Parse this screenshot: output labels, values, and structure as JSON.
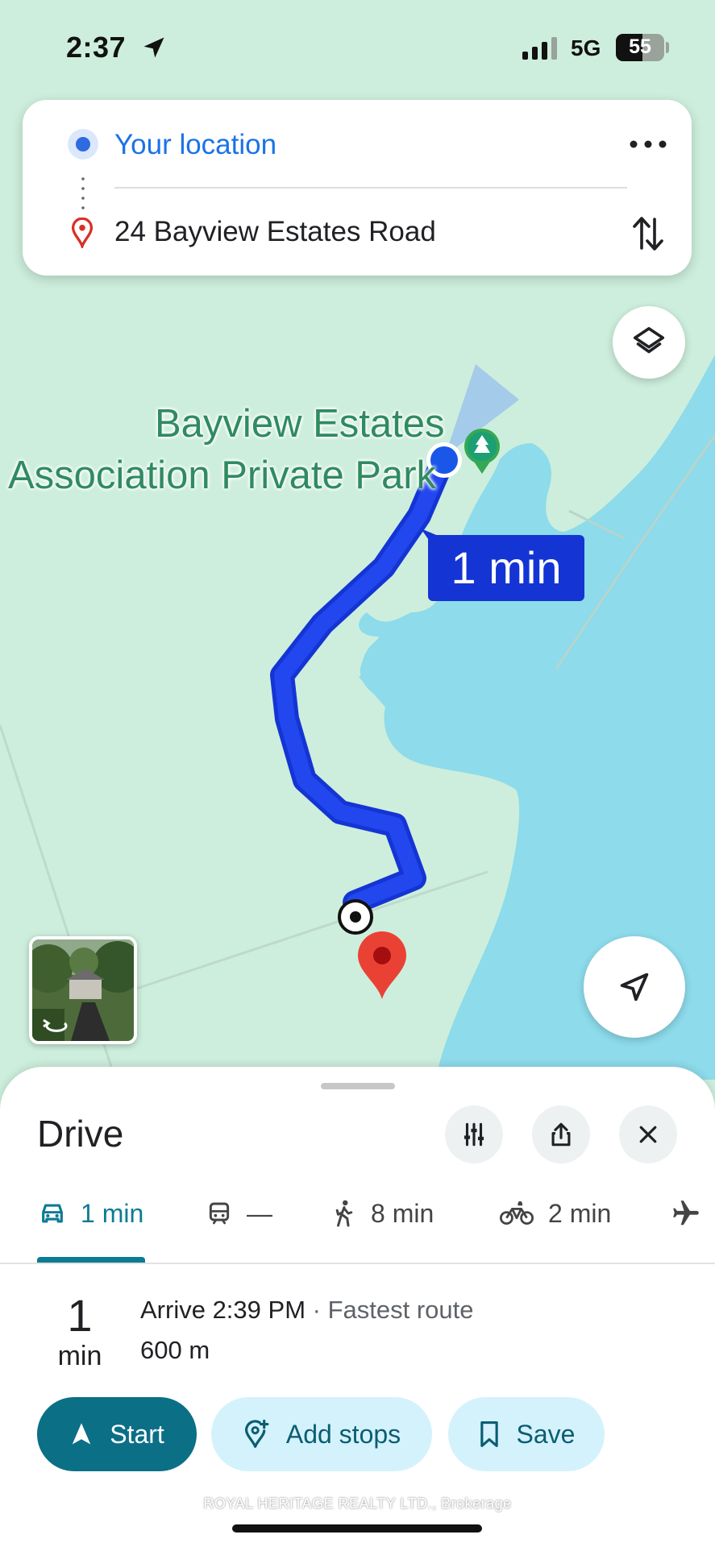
{
  "status_bar": {
    "time": "2:37",
    "network": "5G",
    "battery": "55"
  },
  "directions": {
    "from_label": "Your location",
    "to_label": "24 Bayview Estates Road"
  },
  "map": {
    "park_label_line1": "Bayview Estates",
    "park_label_line2": "Association Private Park",
    "route_eta": "1 min",
    "colors": {
      "land": "#cdeedc",
      "water": "#8ddbeb",
      "route": "#1435d3",
      "route_fill": "#2347ee",
      "pin": "#e94235"
    }
  },
  "sheet": {
    "title": "Drive",
    "modes": [
      {
        "name": "drive",
        "value": "1 min",
        "icon": "car-icon"
      },
      {
        "name": "transit",
        "value": "—",
        "icon": "train-icon"
      },
      {
        "name": "walk",
        "value": "8 min",
        "icon": "walk-icon"
      },
      {
        "name": "bike",
        "value": "2 min",
        "icon": "bike-icon"
      },
      {
        "name": "flight",
        "value": "",
        "icon": "plane-icon"
      }
    ],
    "duration_number": "1",
    "duration_unit": "min",
    "arrive_text": "Arrive 2:39 PM",
    "arrive_separator": " · ",
    "route_note": "Fastest route",
    "distance": "600 m",
    "buttons": {
      "start": "Start",
      "add_stops": "Add stops",
      "save": "Save"
    },
    "watermark": "ROYAL HERITAGE REALTY LTD., Brokerage",
    "accent": "#0b7c93"
  }
}
